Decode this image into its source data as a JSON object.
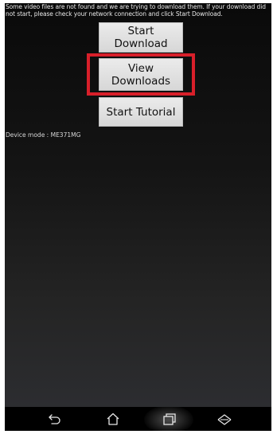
{
  "notice": {
    "text": "Some video files are not found and we are trying to download them. If your download did not start, please check your network connection and click Start Download."
  },
  "buttons": {
    "start_download": "Start Download",
    "view_downloads_line1": "View",
    "view_downloads_line2": "Downloads",
    "start_tutorial": "Start Tutorial"
  },
  "device_mode": "Device mode : ME371MG",
  "colors": {
    "highlight": "#d81f2a"
  },
  "nav_icons": [
    "back-icon",
    "home-icon",
    "recent-apps-icon",
    "menu-icon"
  ]
}
